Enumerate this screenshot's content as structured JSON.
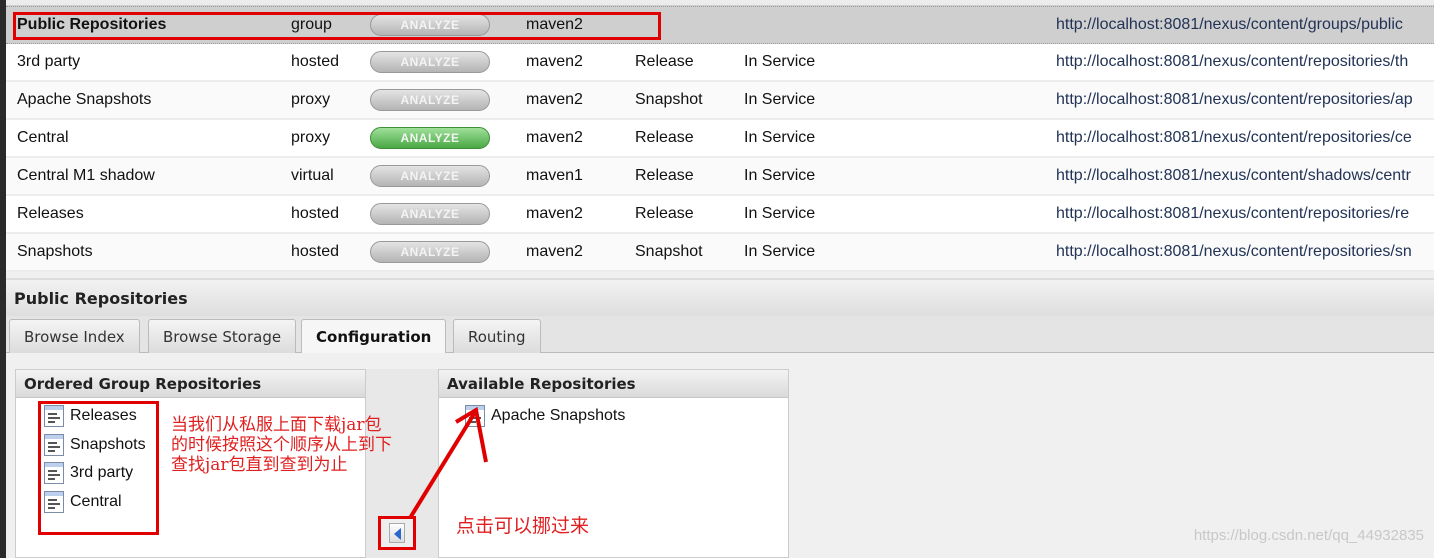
{
  "repositories": [
    {
      "name": "Public Repositories",
      "type": "group",
      "analyze": "ANALYZE",
      "format": "maven2",
      "policy": "",
      "status": "",
      "url": "http://localhost:8081/nexus/content/groups/public",
      "selected": true
    },
    {
      "name": "3rd party",
      "type": "hosted",
      "analyze": "ANALYZE",
      "format": "maven2",
      "policy": "Release",
      "status": "In Service",
      "url": "http://localhost:8081/nexus/content/repositories/th"
    },
    {
      "name": "Apache Snapshots",
      "type": "proxy",
      "analyze": "ANALYZE",
      "format": "maven2",
      "policy": "Snapshot",
      "status": "In Service",
      "url": "http://localhost:8081/nexus/content/repositories/ap"
    },
    {
      "name": "Central",
      "type": "proxy",
      "analyze": "ANALYZE",
      "format": "maven2",
      "policy": "Release",
      "status": "In Service",
      "url": "http://localhost:8081/nexus/content/repositories/ce",
      "analyze_active": true
    },
    {
      "name": "Central M1 shadow",
      "type": "virtual",
      "analyze": "ANALYZE",
      "format": "maven1",
      "policy": "Release",
      "status": "In Service",
      "url": "http://localhost:8081/nexus/content/shadows/centr"
    },
    {
      "name": "Releases",
      "type": "hosted",
      "analyze": "ANALYZE",
      "format": "maven2",
      "policy": "Release",
      "status": "In Service",
      "url": "http://localhost:8081/nexus/content/repositories/re"
    },
    {
      "name": "Snapshots",
      "type": "hosted",
      "analyze": "ANALYZE",
      "format": "maven2",
      "policy": "Snapshot",
      "status": "In Service",
      "url": "http://localhost:8081/nexus/content/repositories/sn"
    }
  ],
  "detail": {
    "title": "Public Repositories",
    "tabs": [
      {
        "label": "Browse Index"
      },
      {
        "label": "Browse Storage"
      },
      {
        "label": "Configuration",
        "active": true
      },
      {
        "label": "Routing"
      }
    ],
    "ordered": {
      "title": "Ordered Group Repositories",
      "items": [
        "Releases",
        "Snapshots",
        "3rd party",
        "Central"
      ]
    },
    "available": {
      "title": "Available Repositories",
      "items": [
        "Apache Snapshots"
      ]
    }
  },
  "annotations": {
    "order_note": [
      "当我们从私服上面下载jar包",
      "的时候按照这个顺序从上到下",
      "查找jar包直到查到为止"
    ],
    "move_note": "点击可以挪过来"
  },
  "watermark": "https://blog.csdn.net/qq_44932835",
  "colors": {
    "highlight": "#e00000",
    "analyze_active": "#4aa845",
    "annotation": "#e02020"
  }
}
